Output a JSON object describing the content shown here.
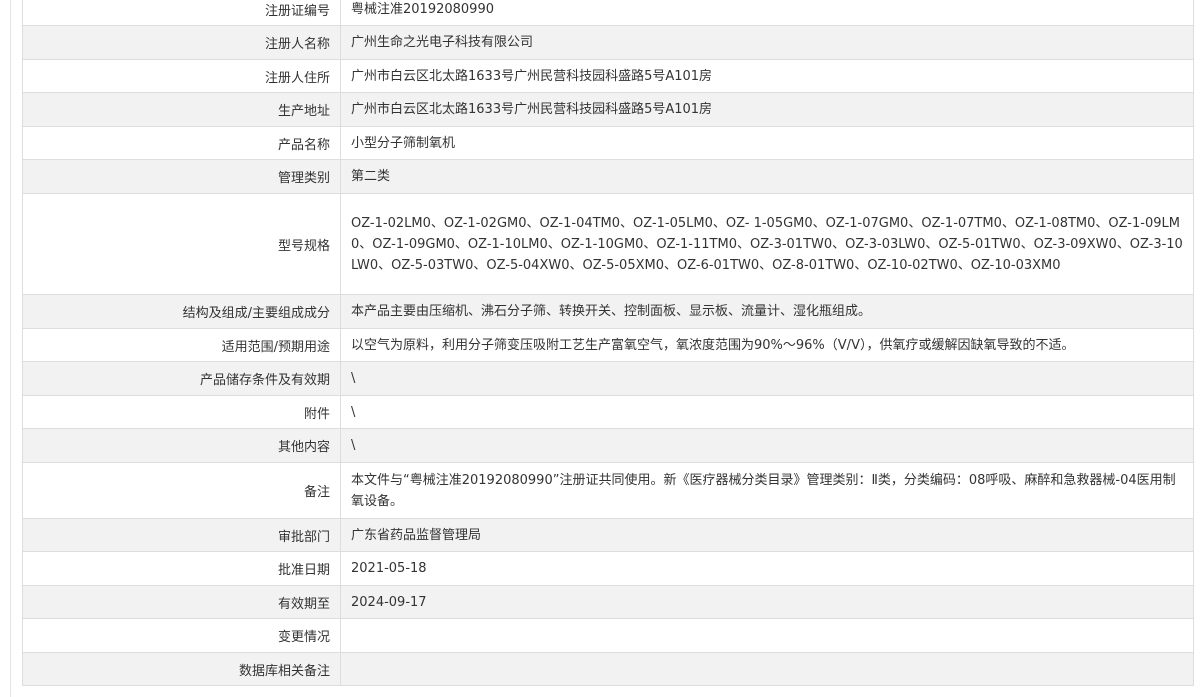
{
  "rows": [
    {
      "label": "注册证编号",
      "value": "粤械注准20192080990"
    },
    {
      "label": "注册人名称",
      "value": "广州生命之光电子科技有限公司"
    },
    {
      "label": "注册人住所",
      "value": "广州市白云区北太路1633号广州民营科技园科盛路5号A101房"
    },
    {
      "label": "生产地址",
      "value": "广州市白云区北太路1633号广州民营科技园科盛路5号A101房"
    },
    {
      "label": "产品名称",
      "value": "小型分子筛制氧机"
    },
    {
      "label": "管理类别",
      "value": "第二类"
    },
    {
      "label": "型号规格",
      "value": "OZ-1-02LM0、OZ-1-02GM0、OZ-1-04TM0、OZ-1-05LM0、OZ- 1-05GM0、OZ-1-07GM0、OZ-1-07TM0、OZ-1-08TM0、OZ-1-09LM0、OZ-1-09GM0、OZ-1-10LM0、OZ-1-10GM0、OZ-1-11TM0、OZ-3-01TW0、OZ-3-03LW0、OZ-5-01TW0、OZ-3-09XW0、OZ-3-10LW0、OZ-5-03TW0、OZ-5-04XW0、OZ-5-05XM0、OZ-6-01TW0、OZ-8-01TW0、OZ-10-02TW0、OZ-10-03XM0"
    },
    {
      "label": "结构及组成/主要组成成分",
      "value": "本产品主要由压缩机、沸石分子筛、转换开关、控制面板、显示板、流量计、湿化瓶组成。"
    },
    {
      "label": "适用范围/预期用途",
      "value": "以空气为原料，利用分子筛变压吸附工艺生产富氧空气，氧浓度范围为90%～96%（V/V），供氧疗或缓解因缺氧导致的不适。"
    },
    {
      "label": "产品储存条件及有效期",
      "value": "\\"
    },
    {
      "label": "附件",
      "value": "\\"
    },
    {
      "label": "其他内容",
      "value": "\\"
    },
    {
      "label": "备注",
      "value": "本文件与“粤械注准20192080990”注册证共同使用。新《医疗器械分类目录》管理类别：Ⅱ类，分类编码：08呼吸、麻醉和急救器械-04医用制氧设备。"
    },
    {
      "label": "审批部门",
      "value": "广东省药品监督管理局"
    },
    {
      "label": "批准日期",
      "value": "2021-05-18"
    },
    {
      "label": "有效期至",
      "value": "2024-09-17"
    },
    {
      "label": "变更情况",
      "value": ""
    },
    {
      "label": "数据库相关备注",
      "value": ""
    }
  ]
}
